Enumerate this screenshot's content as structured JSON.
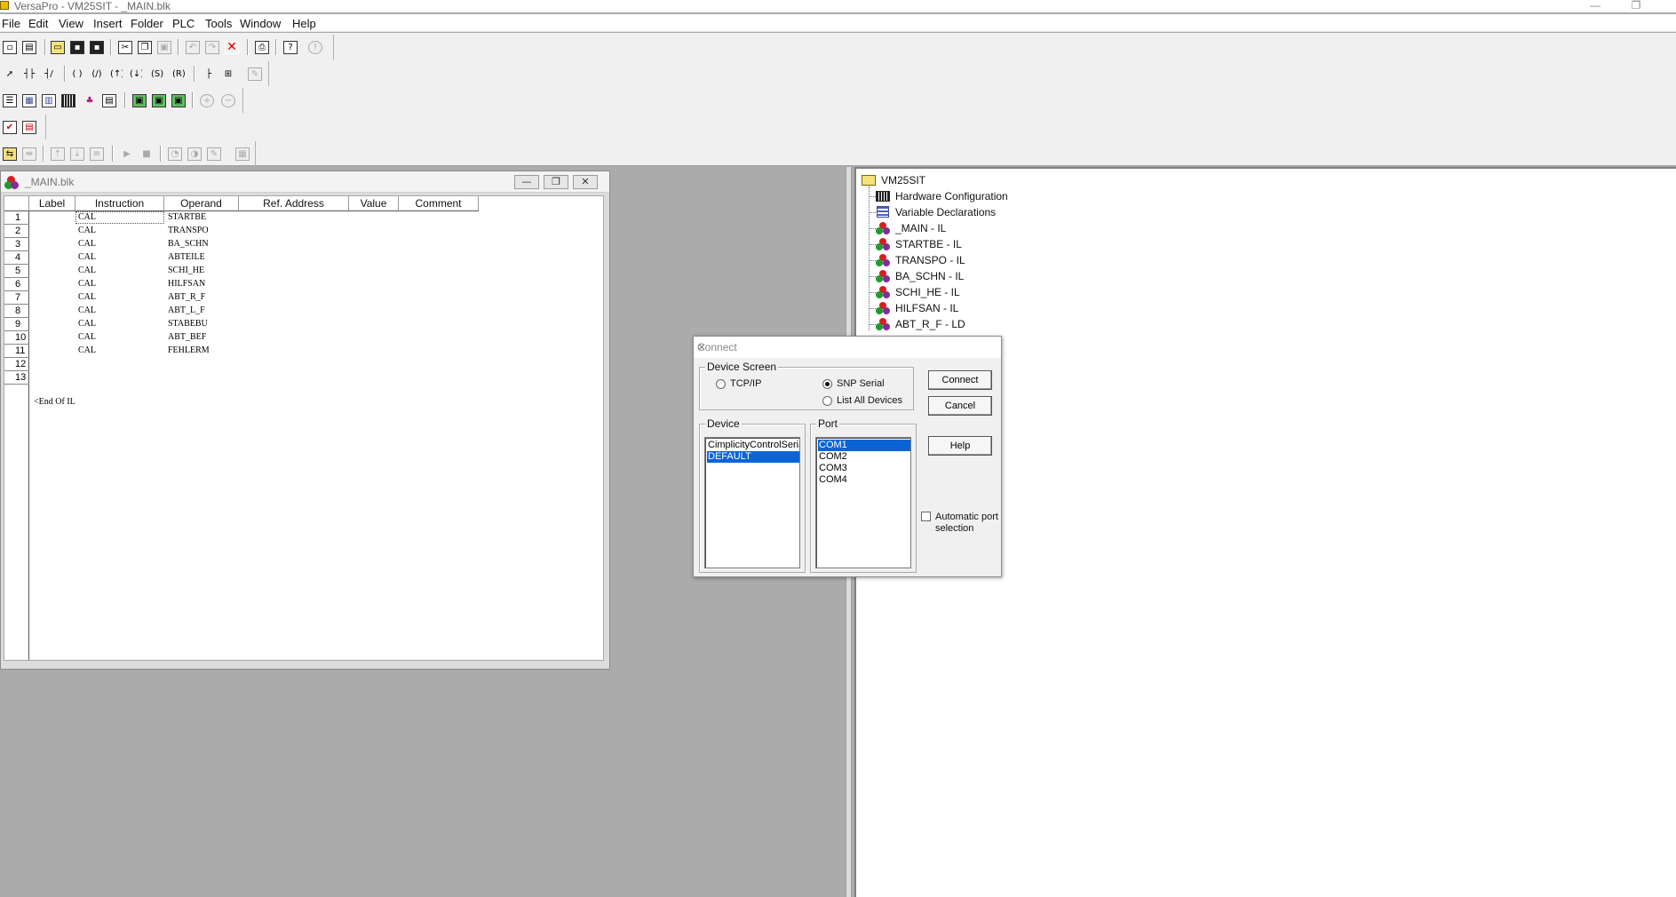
{
  "window": {
    "title": "VersaPro - VM25SIT - _MAIN.blk",
    "minimize_glyph": "—",
    "restore_glyph": "❐"
  },
  "menu": [
    "File",
    "Edit",
    "View",
    "Insert",
    "Folder",
    "PLC",
    "Tools",
    "Window",
    "Help"
  ],
  "toolbars": {
    "row1_icons": [
      "new-file-icon",
      "new-project-icon",
      "open-folder-icon",
      "save-icon",
      "save-all-icon",
      "cut-icon",
      "copy-icon",
      "paste-icon",
      "undo-icon",
      "redo-icon",
      "delete-icon",
      "print-icon",
      "context-help-icon",
      "info-icon"
    ],
    "row2_icons": [
      "select-arrow-icon",
      "contact-no-icon",
      "contact-nc-icon",
      "coil-icon",
      "coil-negated-icon",
      "coil-set-icon",
      "coil-reset-icon",
      "coil-positive-icon",
      "coil-negative-icon",
      "horizontal-link-icon",
      "vertical-link-icon",
      "properties-icon"
    ],
    "row3_icons": [
      "tree-view-icon",
      "variable-table-icon",
      "reference-view-icon",
      "hardware-config-icon",
      "block-icon",
      "list-icon",
      "window-cascade-icon",
      "window-tile-icon",
      "window-arrange-icon",
      "zoom-in-icon",
      "zoom-out-icon"
    ],
    "row4_icons": [
      "check-icon",
      "report-icon"
    ],
    "row5_icons": [
      "plc-connect-icon",
      "plc-disconnect-icon",
      "plc-store-icon",
      "plc-load-icon",
      "plc-verify-icon",
      "plc-run-icon",
      "plc-stop-icon",
      "plc-status-icon",
      "plc-monitor-icon",
      "plc-toggle-icon",
      "plc-table-icon"
    ]
  },
  "main_window": {
    "title": "_MAIN.blk",
    "columns": [
      "Label",
      "Instruction",
      "Operand",
      "Ref. Address",
      "Value",
      "Comment"
    ],
    "rows": [
      {
        "n": "1",
        "instruction": "CAL",
        "operand": "STARTBE"
      },
      {
        "n": "2",
        "instruction": "CAL",
        "operand": "TRANSPO"
      },
      {
        "n": "3",
        "instruction": "CAL",
        "operand": "BA_SCHN"
      },
      {
        "n": "4",
        "instruction": "CAL",
        "operand": "ABTEILE"
      },
      {
        "n": "5",
        "instruction": "CAL",
        "operand": "SCHI_HE"
      },
      {
        "n": "6",
        "instruction": "CAL",
        "operand": "HILFSAN"
      },
      {
        "n": "7",
        "instruction": "CAL",
        "operand": "ABT_R_F"
      },
      {
        "n": "8",
        "instruction": "CAL",
        "operand": "ABT_L_F"
      },
      {
        "n": "9",
        "instruction": "CAL",
        "operand": "STABEBU"
      },
      {
        "n": "10",
        "instruction": "CAL",
        "operand": "ABT_BEF"
      },
      {
        "n": "11",
        "instruction": "CAL",
        "operand": "FEHLERM"
      },
      {
        "n": "12",
        "instruction": "",
        "operand": ""
      },
      {
        "n": "13",
        "instruction": "",
        "operand": ""
      }
    ],
    "end_marker": "<End Of IL",
    "btn_minimize": "—",
    "btn_restore": "❐",
    "btn_close": "✕"
  },
  "tree": {
    "root": "VM25SIT",
    "items": [
      {
        "label": "Hardware Configuration",
        "icon": "hardware-config-icon"
      },
      {
        "label": "Variable Declarations",
        "icon": "variable-declarations-icon"
      },
      {
        "label": "_MAIN - IL",
        "icon": "block-icon"
      },
      {
        "label": "STARTBE - IL",
        "icon": "block-icon"
      },
      {
        "label": "TRANSPO - IL",
        "icon": "block-icon"
      },
      {
        "label": "BA_SCHN - IL",
        "icon": "block-icon"
      },
      {
        "label": "SCHI_HE - IL",
        "icon": "block-icon"
      },
      {
        "label": "HILFSAN - IL",
        "icon": "block-icon"
      },
      {
        "label": "ABT_R_F - LD",
        "icon": "block-icon"
      }
    ]
  },
  "dialog": {
    "title": "Connect",
    "close_glyph": "✕",
    "device_screen": {
      "label": "Device Screen",
      "options": [
        "TCP/IP",
        "SNP Serial",
        "List All Devices"
      ],
      "selected": "SNP Serial"
    },
    "device": {
      "label": "Device",
      "items": [
        "CimplicityControlSerial",
        "DEFAULT"
      ],
      "selected": "DEFAULT"
    },
    "port": {
      "label": "Port",
      "items": [
        "COM1",
        "COM2",
        "COM3",
        "COM4"
      ],
      "selected": "COM1"
    },
    "buttons": {
      "connect": "Connect",
      "cancel": "Cancel",
      "help": "Help"
    },
    "auto_port": {
      "label": "Automatic port selection",
      "checked": false
    }
  },
  "colors": {
    "selection": "#0a64d6",
    "block_icon_red": "#d42020",
    "block_icon_green": "#1f9a2f",
    "block_icon_purple": "#8a2a9a"
  }
}
